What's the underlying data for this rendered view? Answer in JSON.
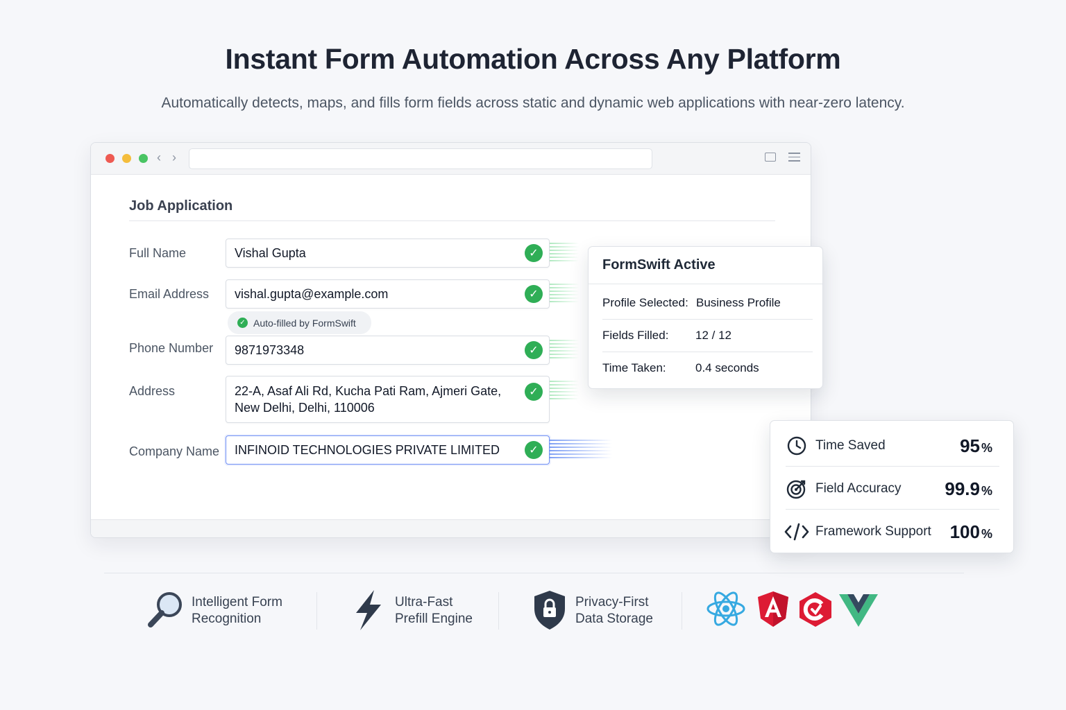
{
  "hero": {
    "title": "Instant Form Automation Across Any Platform",
    "subtitle": "Automatically detects, maps, and fills form fields across static and dynamic web applications with near-zero latency."
  },
  "browser": {
    "url": "",
    "controls": [
      "close",
      "minimize",
      "maximize"
    ],
    "nav": {
      "back": "‹",
      "forward": "›"
    }
  },
  "form": {
    "title": "Job Application",
    "fields": [
      {
        "label": "Full Name",
        "value": "Vishal Gupta"
      },
      {
        "label": "Email Address",
        "value": "vishal.gupta@example.com"
      },
      {
        "label": "Phone Number",
        "value": "9871973348"
      },
      {
        "label": "Address",
        "value_line1": "22-A, Asaf Ali Rd, Kucha Pati Ram, Ajmeri Gate,",
        "value_line2": "New Delhi, Delhi, 110006"
      },
      {
        "label": "Company Name",
        "value": "INFINOID TECHNOLOGIES PRIVATE LIMITED"
      }
    ],
    "autofill_badge": "Auto-filled by FormSwift"
  },
  "formswift_panel": {
    "title": "FormSwift Active",
    "rows": [
      {
        "key": "Profile Selected:",
        "value": "Business Profile"
      },
      {
        "key": "Fields Filled:",
        "value": "12 / 12"
      },
      {
        "key": "Time Taken:",
        "value": "0.4 seconds"
      }
    ]
  },
  "stats": [
    {
      "icon": "clock-icon",
      "label": "Time Saved",
      "value": "95",
      "unit": "%"
    },
    {
      "icon": "target-icon",
      "label": "Field Accuracy",
      "value": "99.9",
      "unit": "%"
    },
    {
      "icon": "code-icon",
      "label": "Framework Support",
      "value": "100",
      "unit": "%"
    }
  ],
  "features": [
    {
      "icon": "magnifier-icon",
      "line1": "Intelligent Form",
      "line2": "Recognition"
    },
    {
      "icon": "lightning-icon",
      "line1": "Ultra-Fast",
      "line2": "Prefill Engine"
    },
    {
      "icon": "shield-lock-icon",
      "line1": "Privacy-First",
      "line2": "Data Storage"
    }
  ],
  "framework_logos": [
    "react-logo",
    "angular-logo",
    "codeigniter-logo",
    "vue-logo"
  ],
  "colors": {
    "success": "#2fae56",
    "accent_blue": "#6f8ff5",
    "text_dark": "#1e2433",
    "react": "#36a9e1",
    "angular": "#dd1b34",
    "vue_dark": "#34495e",
    "vue_green": "#41b883"
  }
}
